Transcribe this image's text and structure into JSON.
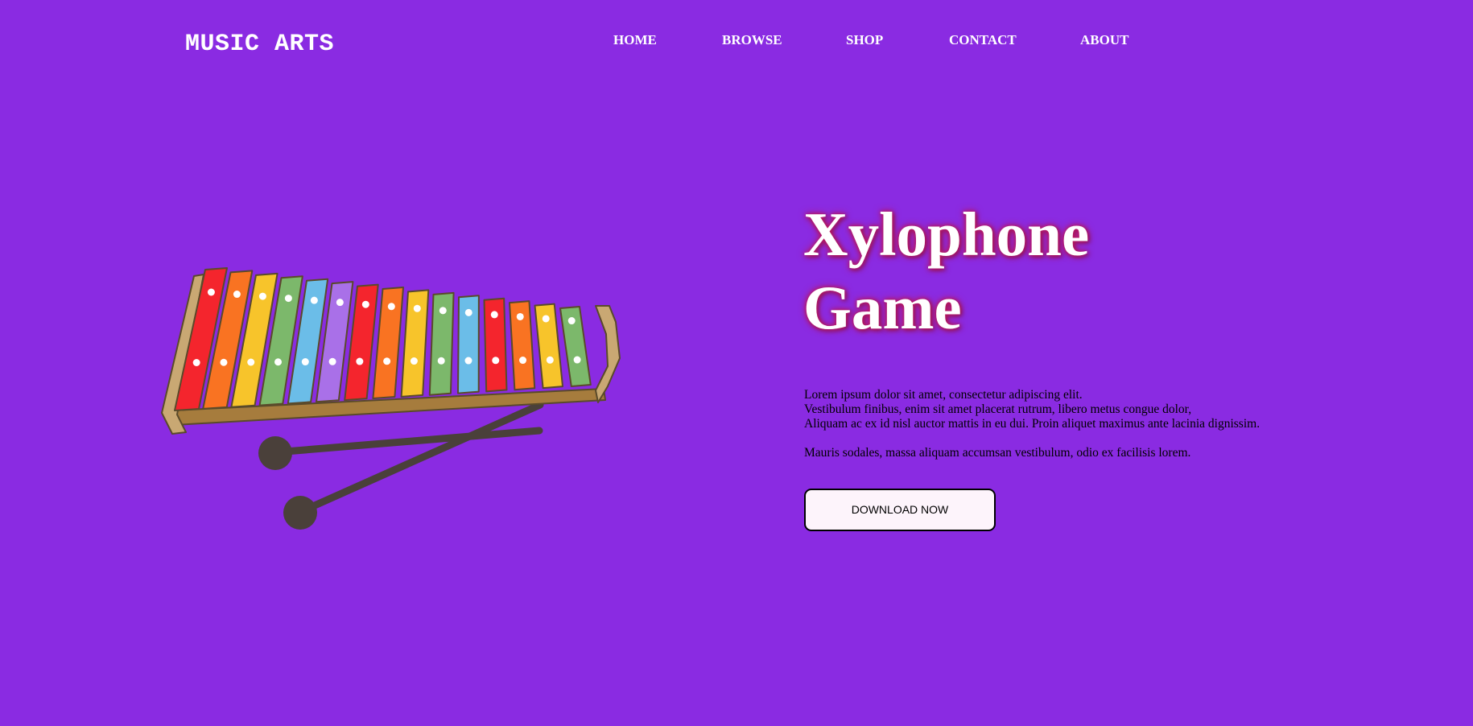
{
  "brand": {
    "logo": "MUSIC ARTS"
  },
  "nav": {
    "items": [
      {
        "label": "HOME"
      },
      {
        "label": "BROWSE"
      },
      {
        "label": "SHOP"
      },
      {
        "label": "CONTACT"
      },
      {
        "label": "ABOUT"
      }
    ]
  },
  "hero": {
    "title_line1": "Xylophone",
    "title_line2": "Game",
    "paragraph1_line1": "Lorem ipsum dolor sit amet, consectetur adipiscing elit.",
    "paragraph1_line2": "Vestibulum finibus, enim sit amet placerat rutrum, libero metus congue dolor,",
    "paragraph1_line3": "Aliquam ac ex id nisl auctor mattis in eu dui. Proin aliquet maximus ante lacinia dignissim.",
    "paragraph2": "Mauris sodales, massa aliquam accumsan vestibulum, odio ex facilisis lorem.",
    "button_label": "DOWNLOAD NOW"
  },
  "colors": {
    "background": "#8a2be2",
    "title_glow": "#c2185b",
    "button_bg": "#fdf4fb",
    "xylophone_frame": "#a67c3d",
    "xylophone_rail": "#c9a873",
    "mallet": "#4a403a",
    "bar_colors": [
      "#f4252d",
      "#f97322",
      "#f7c42b",
      "#7cb86b",
      "#6bbde8",
      "#a970e8",
      "#f4252d",
      "#f97322",
      "#f7c42b",
      "#7cb86b",
      "#6bbde8",
      "#f4252d",
      "#f97322",
      "#f7c42b",
      "#7cb86b"
    ]
  },
  "illustration": {
    "icon": "xylophone-with-mallets-icon"
  }
}
